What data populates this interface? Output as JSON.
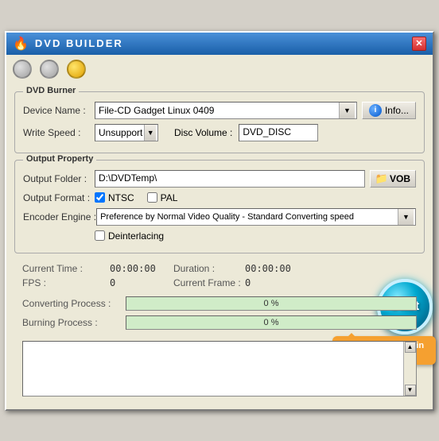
{
  "window": {
    "title": "DVD BUILDER",
    "close_label": "✕"
  },
  "traffic_lights": {
    "btn1": "grey",
    "btn2": "grey",
    "btn3": "yellow"
  },
  "dvd_burner": {
    "group_title": "DVD Burner",
    "device_name_label": "Device Name :",
    "device_name_value": "File-CD Gadget  Linux   0409",
    "info_btn_label": "Info...",
    "write_speed_label": "Write Speed :",
    "write_speed_value": "Unsupport",
    "disc_volume_label": "Disc Volume :",
    "disc_volume_value": "DVD_DISC"
  },
  "output_property": {
    "group_title": "Output Property",
    "output_folder_label": "Output Folder :",
    "output_folder_value": "D:\\DVDTemp\\",
    "vob_btn_label": "VOB",
    "output_format_label": "Output Format :",
    "ntsc_label": "NTSC",
    "pal_label": "PAL",
    "ntsc_checked": true,
    "pal_checked": false,
    "encoder_engine_label": "Encoder Engine :",
    "encoder_engine_value": "Preference by Normal Video Quality - Standard Converting speed",
    "deinterlacing_label": "Deinterlacing"
  },
  "stats": {
    "current_time_label": "Current Time :",
    "current_time_value": "00:00:00",
    "duration_label": "Duration :",
    "duration_value": "00:00:00",
    "fps_label": "FPS :",
    "fps_value": "0",
    "current_frame_label": "Current Frame :",
    "current_frame_value": "0"
  },
  "progress": {
    "converting_label": "Converting Process :",
    "converting_pct": "0 %",
    "burning_label": "Burning Process :",
    "burning_pct": "0 %"
  },
  "start_btn": {
    "label": "Start"
  },
  "tooltip": {
    "text": "Click Start to begin burning DVD"
  }
}
